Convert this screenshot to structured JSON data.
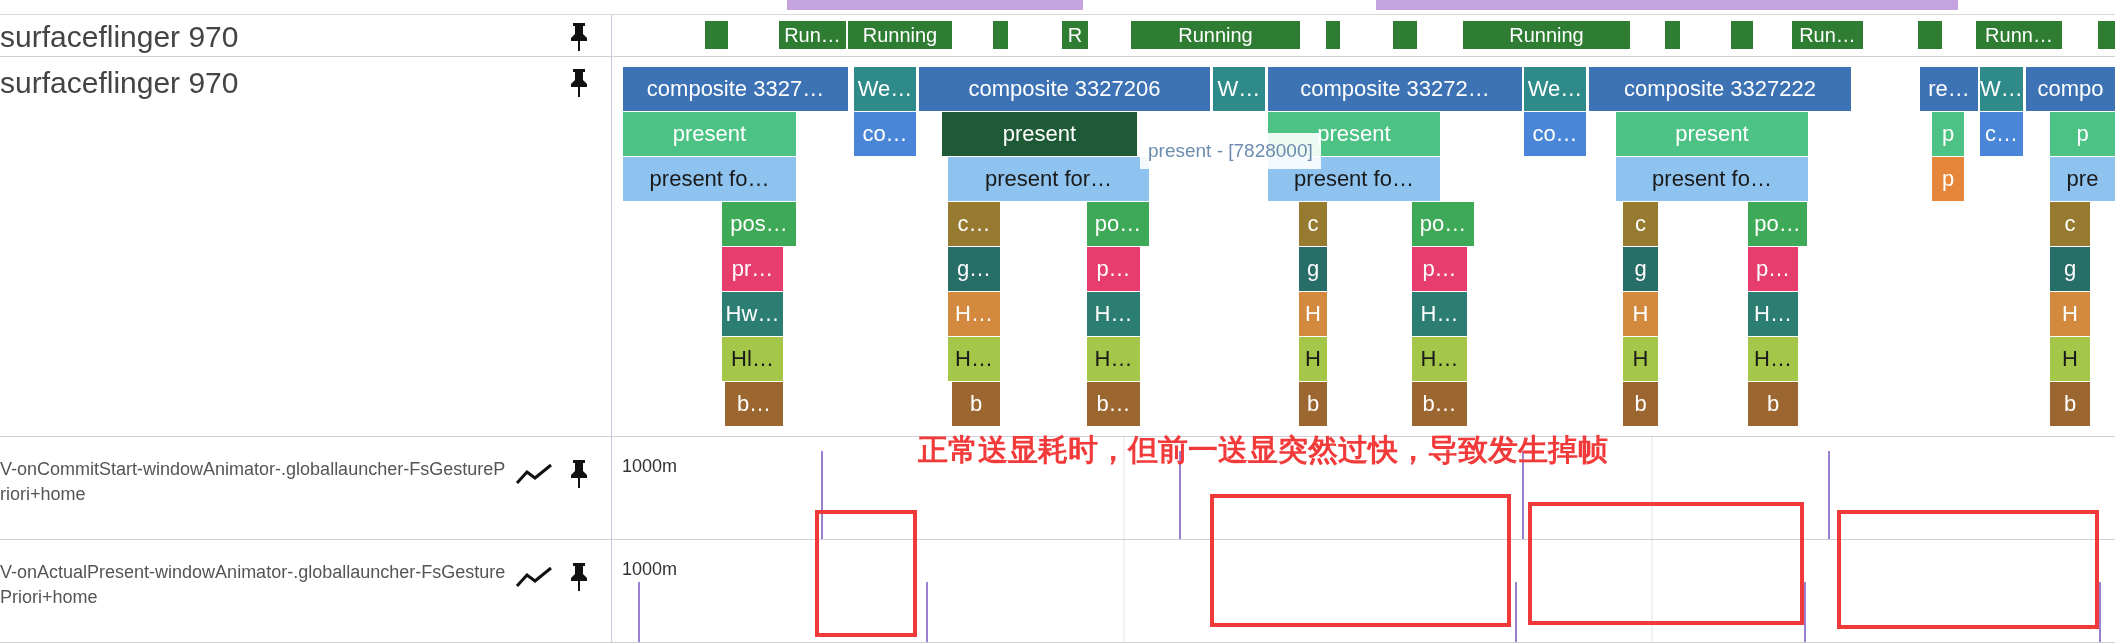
{
  "tracks": [
    {
      "kind": "thread_state",
      "title": "surfaceflinger 970"
    },
    {
      "kind": "slices",
      "title": "surfaceflinger 970"
    },
    {
      "kind": "counter",
      "title": "V-onCommitStart-windowAnimator-.globallauncher-FsGesturePriori+home",
      "scale": "1000m"
    },
    {
      "kind": "counter",
      "title": "V-onActualPresent-windowAnimator-.globallauncher-FsGesturePriori+home",
      "scale": "1000m"
    }
  ],
  "thread_states": [
    {
      "kind": "bare"
    },
    {
      "kind": "labeled",
      "label": "Run…"
    },
    {
      "kind": "labeled",
      "label": "Running"
    },
    {
      "kind": "bare"
    },
    {
      "kind": "labeled",
      "label": "R"
    },
    {
      "kind": "labeled",
      "label": "Running"
    },
    {
      "kind": "bare"
    },
    {
      "kind": "bare"
    },
    {
      "kind": "labeled",
      "label": "Running"
    },
    {
      "kind": "bare"
    },
    {
      "kind": "bare"
    },
    {
      "kind": "labeled",
      "label": "Run…"
    },
    {
      "kind": "bare"
    },
    {
      "kind": "labeled",
      "label": "Runn…"
    },
    {
      "kind": "bare"
    }
  ],
  "slice_levels": [
    [
      {
        "label": "composite 3327…",
        "color": "#3d72b4"
      },
      {
        "label": "We…",
        "color": "#2f8a8a"
      },
      {
        "label": "composite 3327206",
        "color": "#3d72b4"
      },
      {
        "label": "W…",
        "color": "#2f8a8a"
      },
      {
        "label": "composite 33272…",
        "color": "#3d72b4"
      },
      {
        "label": "We…",
        "color": "#2f8a8a"
      },
      {
        "label": "composite 3327222",
        "color": "#3d72b4"
      },
      {
        "label": "re…",
        "color": "#3d72b4"
      },
      {
        "label": "W…",
        "color": "#2f8a8a"
      },
      {
        "label": "compo",
        "color": "#3d72b4"
      }
    ],
    [
      {
        "label": "present",
        "color": "#4cc285"
      },
      {
        "label": "co…",
        "color": "#4a86d8"
      },
      {
        "label": "present",
        "color": "#1e5a36"
      },
      {
        "label": "present",
        "color": "#4cc285"
      },
      {
        "label": "co…",
        "color": "#4a86d8"
      },
      {
        "label": "present",
        "color": "#4cc285"
      },
      {
        "label": "p",
        "color": "#4cc285"
      },
      {
        "label": "c…",
        "color": "#4a86d8"
      },
      {
        "label": "p",
        "color": "#4cc285"
      }
    ],
    [
      {
        "label": "present fo…",
        "color": "#8ec3ef"
      },
      {
        "label": "present for…",
        "color": "#8ec3ef"
      },
      {
        "label": "present fo…",
        "color": "#8ec3ef"
      },
      {
        "label": "present fo…",
        "color": "#8ec3ef"
      },
      {
        "label": "p",
        "color": "#e5863a"
      },
      {
        "label": "pre",
        "color": "#8ec3ef"
      }
    ],
    [
      {
        "label": "pos…",
        "color": "#3ea957"
      },
      {
        "label": "c…",
        "color": "#957a2f"
      },
      {
        "label": "po…",
        "color": "#3ea957"
      },
      {
        "label": "c",
        "color": "#957a2f"
      },
      {
        "label": "po…",
        "color": "#3ea957"
      },
      {
        "label": "c",
        "color": "#957a2f"
      },
      {
        "label": "po…",
        "color": "#3ea957"
      },
      {
        "label": "c",
        "color": "#957a2f"
      }
    ],
    [
      {
        "label": "pr…",
        "color": "#e63d6e"
      },
      {
        "label": "g…",
        "color": "#276d68"
      },
      {
        "label": "p…",
        "color": "#e63d6e"
      },
      {
        "label": "g",
        "color": "#276d68"
      },
      {
        "label": "p…",
        "color": "#e63d6e"
      },
      {
        "label": "g",
        "color": "#276d68"
      },
      {
        "label": "p…",
        "color": "#e63d6e"
      },
      {
        "label": "g",
        "color": "#276d68"
      }
    ],
    [
      {
        "label": "Hw…",
        "color": "#2d7e72"
      },
      {
        "label": "H…",
        "color": "#d38a3e"
      },
      {
        "label": "H…",
        "color": "#2d7e72"
      },
      {
        "label": "H",
        "color": "#d38a3e"
      },
      {
        "label": "H…",
        "color": "#2d7e72"
      },
      {
        "label": "H",
        "color": "#d38a3e"
      },
      {
        "label": "H…",
        "color": "#2d7e72"
      },
      {
        "label": "H",
        "color": "#d38a3e"
      }
    ],
    [
      {
        "label": "Hl…",
        "color": "#a4c74a"
      },
      {
        "label": "H…",
        "color": "#a4c74a"
      },
      {
        "label": "H…",
        "color": "#a4c74a"
      },
      {
        "label": "H",
        "color": "#a4c74a"
      },
      {
        "label": "H…",
        "color": "#a4c74a"
      },
      {
        "label": "H",
        "color": "#a4c74a"
      },
      {
        "label": "H…",
        "color": "#a4c74a"
      },
      {
        "label": "H",
        "color": "#a4c74a"
      }
    ],
    [
      {
        "label": "b…",
        "color": "#9c6630"
      },
      {
        "label": "b",
        "color": "#9c6630"
      },
      {
        "label": "b…",
        "color": "#9c6630"
      },
      {
        "label": "b",
        "color": "#9c6630"
      },
      {
        "label": "b…",
        "color": "#9c6630"
      },
      {
        "label": "b",
        "color": "#9c6630"
      },
      {
        "label": "b",
        "color": "#9c6630"
      },
      {
        "label": "b",
        "color": "#9c6630"
      }
    ]
  ],
  "tooltip": "present - [7828000]",
  "annotation": "正常送显耗时，但前一送显突然过快，导致发生掉帧"
}
